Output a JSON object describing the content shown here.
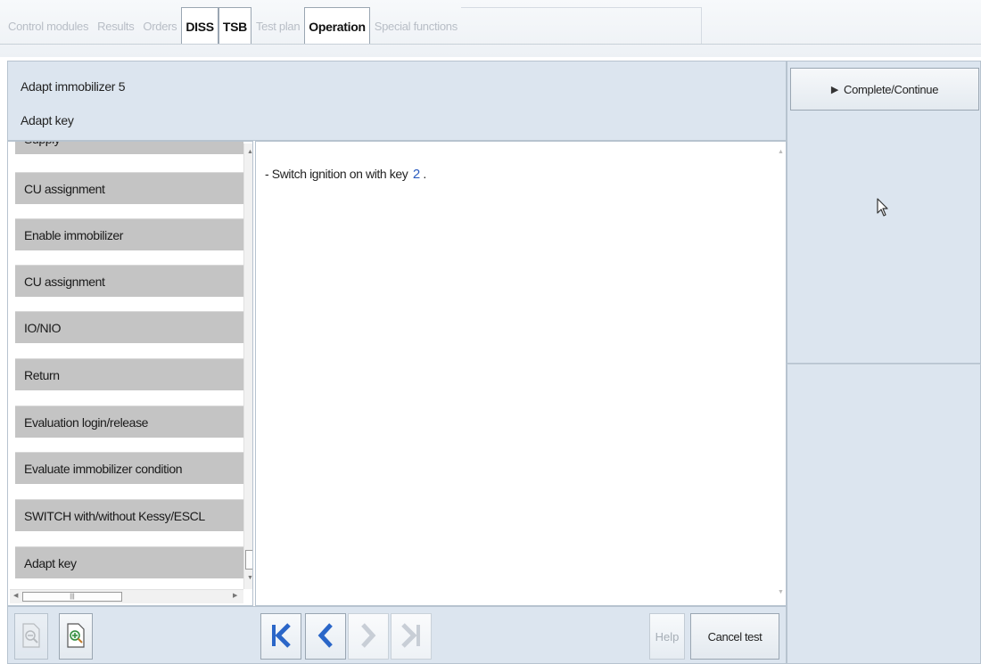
{
  "tabs": [
    {
      "label": "Control modules",
      "active": false
    },
    {
      "label": "Results",
      "active": false
    },
    {
      "label": "Orders",
      "active": false
    },
    {
      "label": "DISS",
      "active": true
    },
    {
      "label": "TSB",
      "active": true
    },
    {
      "label": "Test plan",
      "active": false
    },
    {
      "label": "Operation",
      "active": true
    },
    {
      "label": "Special functions",
      "active": false
    }
  ],
  "header": {
    "title": "Adapt immobilizer 5",
    "subtitle": "Adapt key"
  },
  "right_panel": {
    "complete_label": "Complete/Continue"
  },
  "steps": [
    {
      "label": "Supply"
    },
    {
      "label": "CU assignment"
    },
    {
      "label": "Enable immobilizer"
    },
    {
      "label": "CU assignment"
    },
    {
      "label": "IO/NIO"
    },
    {
      "label": "Return"
    },
    {
      "label": "Evaluation login/release"
    },
    {
      "label": "Evaluate immobilizer condition"
    },
    {
      "label": "SWITCH with/without Kessy/ESCL"
    },
    {
      "label": "Adapt key"
    }
  ],
  "content": {
    "instruction_prefix": "- Switch ignition on with key",
    "key_number": "2",
    "instruction_suffix": "."
  },
  "bottom": {
    "help_label": "Help",
    "cancel_label": "Cancel test",
    "nav_icons": [
      "first-icon",
      "previous-icon",
      "next-icon",
      "last-icon"
    ]
  },
  "colors": {
    "panel": "#dce5ef",
    "step_bg": "#c4c4c4",
    "nav_blue": "#2a66c8",
    "key_blue": "#2a5bbf"
  }
}
